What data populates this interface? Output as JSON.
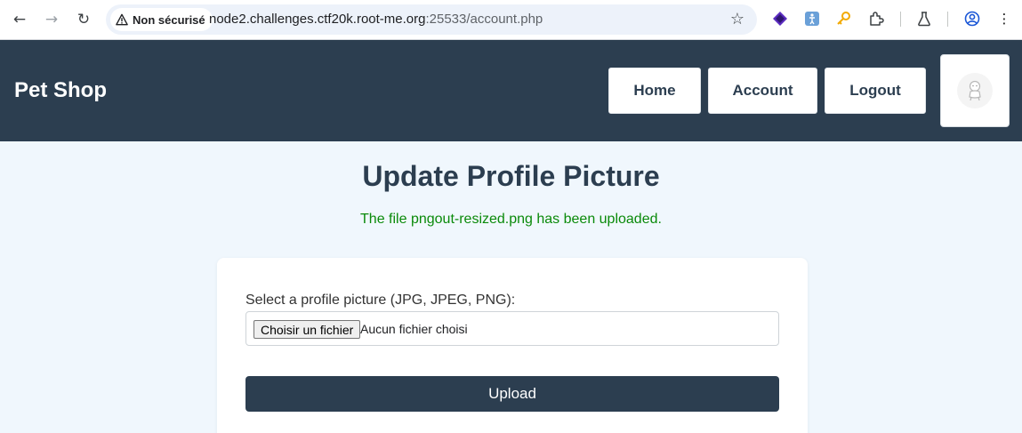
{
  "browser": {
    "back_icon": "←",
    "forward_icon": "→",
    "reload_icon": "↻",
    "security_label": "Non sécurisé",
    "url_host": "node2.challenges.ctf20k.root-me.org",
    "url_rest": ":25533/account.php",
    "bookmark_icon": "☆",
    "menu_icon": "⋮"
  },
  "site": {
    "brand": "Pet Shop",
    "nav": {
      "home": "Home",
      "account": "Account",
      "logout": "Logout"
    }
  },
  "main": {
    "title": "Update Profile Picture",
    "message": "The file pngout-resized.png has been uploaded.",
    "form": {
      "label": "Select a profile picture (JPG, JPEG, PNG):",
      "choose_button": "Choisir un fichier",
      "file_status": "Aucun fichier choisi",
      "upload_button": "Upload"
    }
  },
  "colors": {
    "header_bg": "#2c3e50",
    "page_bg": "#f0f7fd",
    "success_text": "#0a8a0a"
  }
}
